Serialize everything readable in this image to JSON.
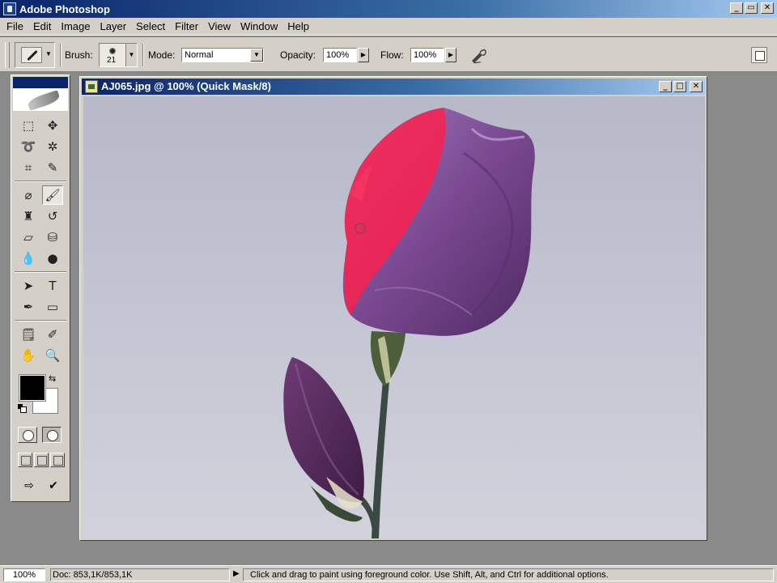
{
  "app": {
    "title": "Adobe Photoshop",
    "window_buttons": [
      "_",
      "▭",
      "✕"
    ]
  },
  "menu": [
    "File",
    "Edit",
    "Image",
    "Layer",
    "Select",
    "Filter",
    "View",
    "Window",
    "Help"
  ],
  "options": {
    "brush_label": "Brush:",
    "brush_size": "21",
    "mode_label": "Mode:",
    "mode_value": "Normal",
    "opacity_label": "Opacity:",
    "opacity_value": "100%",
    "flow_label": "Flow:",
    "flow_value": "100%"
  },
  "tools": {
    "active": "brush",
    "foreground_color": "#000000",
    "background_color": "#ffffff",
    "mode": "quick-mask"
  },
  "document": {
    "title": "AJ065.jpg @ 100% (Quick Mask/8)",
    "window_buttons": [
      "_",
      "□",
      "✕"
    ]
  },
  "status": {
    "zoom": "100%",
    "doc_size": "Doc: 853,1K/853,1K",
    "hint": "Click and drag to paint using foreground color.  Use Shift, Alt, and Ctrl for additional options."
  },
  "colors": {
    "titlebar_start": "#0a246a",
    "chrome": "#d4d0c8",
    "mask_overlay": "#ff1f4a",
    "petal": "#7d4a92"
  }
}
